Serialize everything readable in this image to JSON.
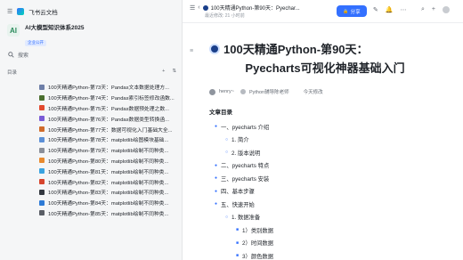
{
  "app": {
    "title": "飞书云文档"
  },
  "kb": {
    "avatar": "AI",
    "title": "AI大模型知识体系2025",
    "badge": "企业公开"
  },
  "search": {
    "placeholder": "搜索"
  },
  "directory": {
    "label": "目录",
    "add": "+",
    "more": "⇅"
  },
  "sidebar": {
    "items": [
      {
        "label": "100天精通Python-第73天：Pandas文本数据处理方...",
        "icon_color": "#6e7fa8"
      },
      {
        "label": "100天精通Python-第74天：Pandas索引标签修改函数...",
        "icon_color": "#4b6f2f"
      },
      {
        "label": "100天精通Python-第75天：Pandas数据预处理之数...",
        "icon_color": "#e2492e"
      },
      {
        "label": "100天精通Python-第76天：Pandas数据类型转换函...",
        "icon_color": "#7a5bd6"
      },
      {
        "label": "100天精通Python-第77天：数据可视化入门基础大全...",
        "icon_color": "#d06b2b"
      },
      {
        "label": "100天精通Python-第78天：matplotlib绘图模块基础...",
        "icon_color": "#5b8fd6"
      },
      {
        "label": "100天精通Python-第79天：matplotlib绘制不同种类...",
        "icon_color": "#8a8f99"
      },
      {
        "label": "100天精通Python-第80天：matplotlib绘制不同种类...",
        "icon_color": "#e88a2e"
      },
      {
        "label": "100天精通Python-第81天：matplotlib绘制不同种类...",
        "icon_color": "#3aa3e0"
      },
      {
        "label": "100天精通Python-第82天：matplotlib绘制不同种类...",
        "icon_color": "#d6452e"
      },
      {
        "label": "100天精通Python-第83天：matplotlib绘制不同种类...",
        "icon_color": "#333840"
      },
      {
        "label": "100天精通Python-第84天：matplotlib绘制不同种类...",
        "icon_color": "#2e7bd6"
      },
      {
        "label": "100天精通Python-第85天：matplotlib绘制不同种类...",
        "icon_color": "#5a5e66"
      }
    ]
  },
  "header": {
    "breadcrumb": "100天精通Python-第90天：Pyechar...",
    "meta": "最近修改: 21 小时前",
    "share": "分享"
  },
  "doc": {
    "title_line1": "100天精通Python-第90天：",
    "title_line2": "Pyecharts可视化神器基础入门",
    "author": "henry~",
    "collaborator": "Python辅导陈老师",
    "modified": "今天修改",
    "toc_title": "文章目录",
    "toc": [
      {
        "label": "一、pyecharts 介绍",
        "indent": 1
      },
      {
        "label": "1. 简介",
        "indent": 2
      },
      {
        "label": "2. 版本说明",
        "indent": 2
      },
      {
        "label": "二、pyecharts 特点",
        "indent": 1
      },
      {
        "label": "三、pyecharts 安装",
        "indent": 1
      },
      {
        "label": "四、基本步骤",
        "indent": 1
      },
      {
        "label": "五、快速开始",
        "indent": 1
      },
      {
        "label": "1. 数据准备",
        "indent": 2
      },
      {
        "label": "1）类别数据",
        "indent": 3
      },
      {
        "label": "2）时间数据",
        "indent": 3
      },
      {
        "label": "3）颜色数据",
        "indent": 3
      }
    ]
  }
}
